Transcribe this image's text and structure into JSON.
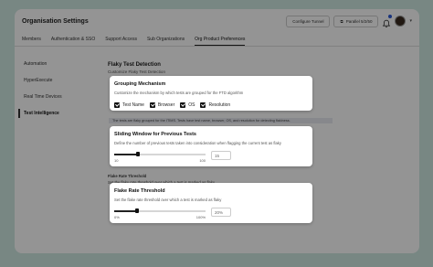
{
  "header": {
    "title": "Organisation Settings",
    "configure_tunnel": "Configure Tunnel",
    "parallel": "Parallel 5/2/50"
  },
  "tabs": [
    {
      "label": "Members"
    },
    {
      "label": "Authentication & SSO"
    },
    {
      "label": "Support Access"
    },
    {
      "label": "Sub Organizations"
    },
    {
      "label": "Org Product Preferences"
    }
  ],
  "sidebar": {
    "items": [
      {
        "label": "Automation"
      },
      {
        "label": "HyperExecute"
      },
      {
        "label": "Real Time Devices"
      },
      {
        "label": "Test Intelligence"
      }
    ]
  },
  "main": {
    "title": "Flaky Test Detection",
    "subtitle": "Customize Flaky Test Detection",
    "banner": "The tests are flaky grouped for the ITIMS. Tests have test name, browser, OS, and resolution for detecting flakiness.",
    "bg_flake_title": "Flake Rate Threshold",
    "bg_flake_desc": "Set the flaky rate threshold over which a test is marked as flaky"
  },
  "grouping": {
    "title": "Grouping Mechanism",
    "description": "Customize the mechanism by which tests are grouped for the FTD algorithm",
    "options": [
      {
        "label": "Test Name",
        "checked": true
      },
      {
        "label": "Browser",
        "checked": true
      },
      {
        "label": "OS",
        "checked": true
      },
      {
        "label": "Resolution",
        "checked": true
      }
    ]
  },
  "sliding_window": {
    "title": "Sliding Window for Previous Tests",
    "description": "Define the number of previous tests taken into consideration when flagging the current test as flaky",
    "min": "10",
    "max": "100",
    "value": 15,
    "value_label": "15"
  },
  "flake_rate": {
    "title": "Flake Rate Threshold",
    "description": "Set the flake rate threshold over which a test is marked as flaky",
    "min": "0%",
    "max": "100%",
    "value": 20,
    "value_label": "20%"
  }
}
